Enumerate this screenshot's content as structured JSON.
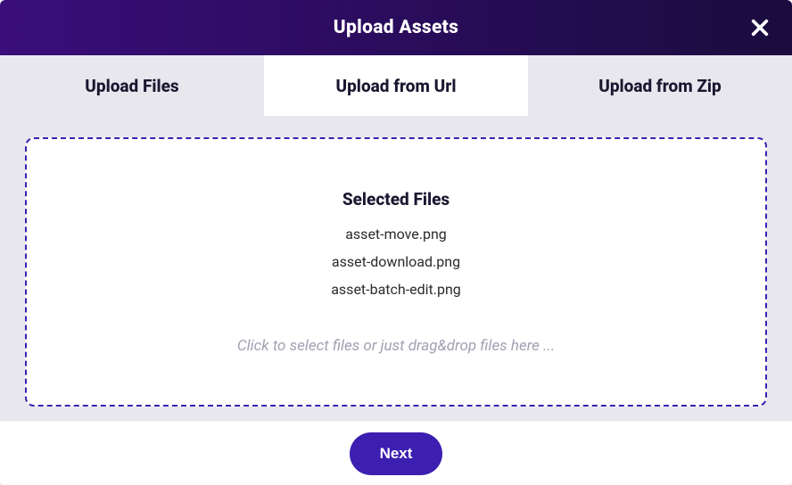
{
  "header": {
    "title": "Upload Assets"
  },
  "tabs": {
    "upload_files": "Upload Files",
    "upload_url": "Upload from Url",
    "upload_zip": "Upload from Zip"
  },
  "dropzone": {
    "title": "Selected Files",
    "files": {
      "0": "asset-move.png",
      "1": "asset-download.png",
      "2": "asset-batch-edit.png"
    },
    "hint": "Click to select files or just drag&drop files here ..."
  },
  "footer": {
    "next_label": "Next"
  }
}
